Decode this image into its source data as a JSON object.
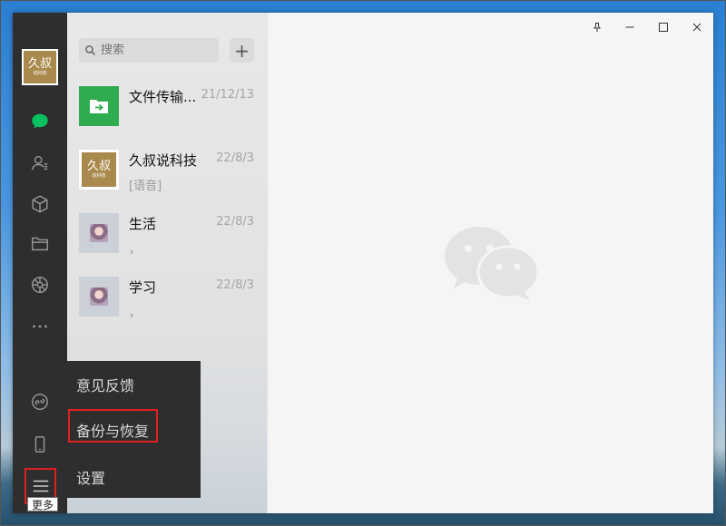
{
  "sidebar": {
    "avatar": {
      "line1": "久叔",
      "line2": "说科技"
    },
    "icons": [
      "chat-icon",
      "contacts-icon",
      "favorites-icon",
      "folder-icon",
      "moments-icon",
      "more-dots-icon",
      "mini-program-icon",
      "phone-icon",
      "menu-icon"
    ],
    "active_color": "#07c160"
  },
  "search": {
    "placeholder": "搜索"
  },
  "add_button": "+",
  "chats": [
    {
      "name": "文件传输...",
      "time": "21/12/13",
      "preview": ""
    },
    {
      "name": "久叔说科技",
      "time": "22/8/3",
      "preview": "[语音]"
    },
    {
      "name": "生活",
      "time": "22/8/3",
      "preview": "，"
    },
    {
      "name": "学习",
      "time": "22/8/3",
      "preview": "，"
    }
  ],
  "popup_menu": {
    "items": [
      "意见反馈",
      "备份与恢复",
      "设置"
    ]
  },
  "tooltip": "更多",
  "window_controls": [
    "pin-icon",
    "minimize-icon",
    "maximize-icon",
    "close-icon"
  ]
}
